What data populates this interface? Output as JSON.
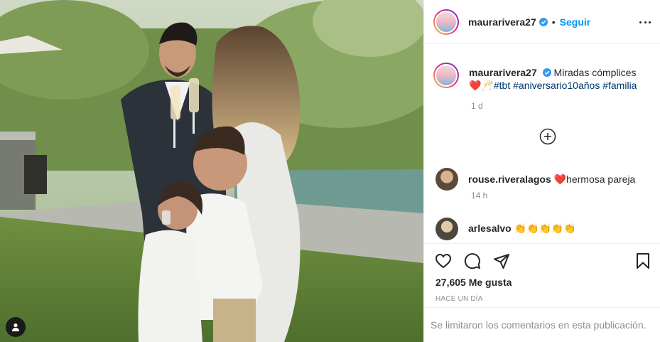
{
  "header": {
    "username": "maurarivera27",
    "separator": "•",
    "follow_label": "Seguir",
    "more_icon": "more-dots-icon"
  },
  "caption": {
    "username": "maurarivera27",
    "text": "Miradas cómplices",
    "emoji": "❤️🥂",
    "hashtags": [
      "#tbt",
      "#aniversario10años",
      "#familia"
    ],
    "time": "1 d"
  },
  "load_more_icon": "plus-circle-icon",
  "comments": [
    {
      "username": "rouse.riveralagos",
      "emoji": "❤️",
      "text": "hermosa pareja",
      "time": "14 h"
    },
    {
      "username": "arlesalvo",
      "text": "👏👏👏👏👏"
    }
  ],
  "actions": {
    "like_icon": "heart-icon",
    "comment_icon": "comment-icon",
    "share_icon": "paper-plane-icon",
    "save_icon": "bookmark-icon"
  },
  "likes": "27,605 Me gusta",
  "posted_ago": "HACE UN DÍA",
  "comments_limited": "Se limitaron los comentarios en esta publicación.",
  "colors": {
    "link": "#0095f6",
    "hashtag": "#00376b",
    "muted": "#8e8e8e",
    "text": "#262626",
    "verified": "#3897f0"
  }
}
